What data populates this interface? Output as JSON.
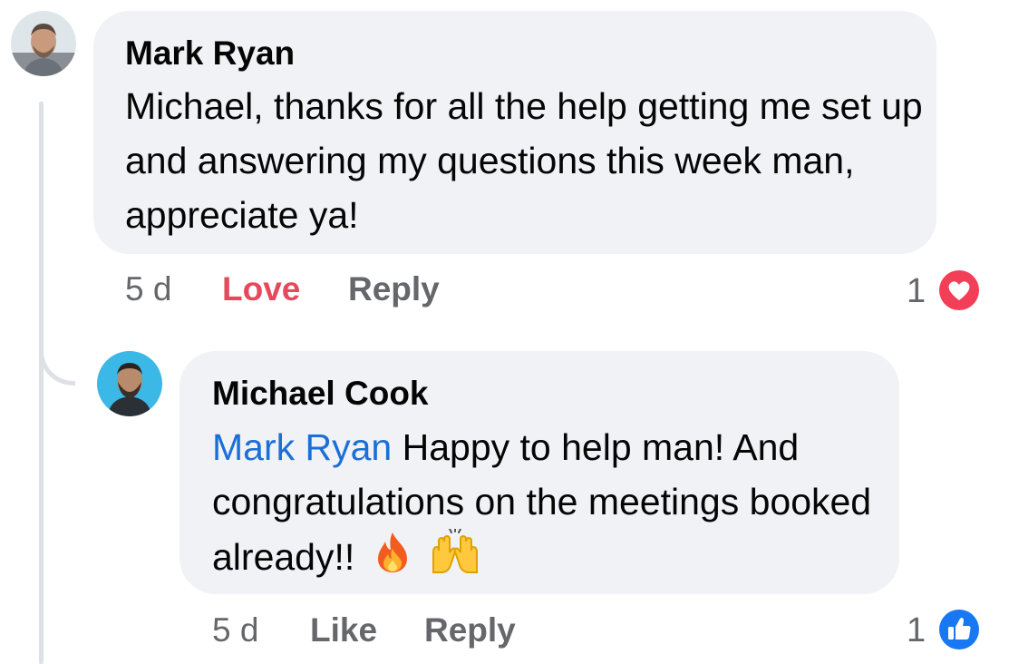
{
  "comments": [
    {
      "author": "Mark Ryan",
      "text": "Michael, thanks for all the help getting me set up and answering my questions this week man, appreciate ya!",
      "time": "5 d",
      "reaction_action": "Love",
      "reply_label": "Reply",
      "reaction_count": "1",
      "reaction_icon": "heart-reaction",
      "reaction_color": "#f33e58"
    },
    {
      "author": "Michael Cook",
      "mention": "Mark Ryan",
      "text": " Happy to help man! And congratulations on the meetings booked already!!",
      "emojis": [
        "🔥",
        "🙌"
      ],
      "time": "5 d",
      "reaction_action": "Like",
      "reply_label": "Reply",
      "reaction_count": "1",
      "reaction_icon": "like-reaction",
      "reaction_color": "#1877f2"
    }
  ],
  "colors": {
    "bubble": "#f0f2f5",
    "mention": "#1b6fd6",
    "love": "#e5495c",
    "meta": "#65676b",
    "thread_line": "#dde1e6"
  }
}
